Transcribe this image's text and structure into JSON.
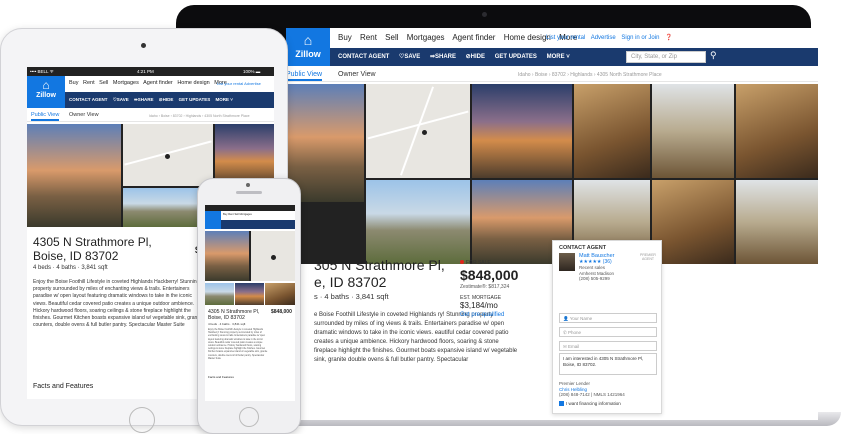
{
  "listing": {
    "address_line1": "4305 N Strathmore Pl,",
    "address_line2": "Boise, ID 83702",
    "address_line1_cut": "305 N Strathmore Pl,",
    "address_line2_cut": "e, ID 83702",
    "meta": "4 beds · 4 baths · 3,841 sqft",
    "meta_cut": "s · 4 baths · 3,841 sqft",
    "status": "FOR SALE",
    "price": "$848,000",
    "zestimate": "Zestimate®: $817,324",
    "est_mortgage_label": "EST. MORTGAGE",
    "est_mortgage_value": "$3,184/mo",
    "prequalified": "Get pre-qualified",
    "description": "Enjoy the Boise Foothill Lifestyle in coveted Highlands Hackberry! Stunning property surrounded by miles of enchanting views & trails. Entertainers paradise w/ open layout featuring dramatic windows to take in the iconic views. Beautiful cedar covered patio creates a unique outdoor ambience. Hickory hardwood floors, soaring ceilings & stone fireplace highlight the finishes. Gourmet Kitchen boasts expansive island w/ vegetable sink, granite counters, double ovens & full butler pantry. Spectacular Master Suite",
    "description_cut": "e Boise Foothill Lifestyle in coveted Highlands ry! Stunning property surrounded by miles of ing views & trails. Entertainers paradise w/ open dramatic windows to take in the iconic views. eautiful cedar covered patio creates a unique ambience. Hickory hardwood floors, soaring & stone fireplace highlight the finishes. Gourmet boats expansive island w/ vegetable sink, granite double ovens & full butler pantry. Spectacular",
    "facts_heading": "Facts and Features"
  },
  "nav": {
    "logo_text": "Zillow",
    "items": [
      "Buy",
      "Rent",
      "Sell",
      "Mortgages",
      "Agent finder",
      "Home design",
      "More"
    ],
    "right_links": [
      "List your rental",
      "Advertise",
      "Sign in or Join"
    ],
    "toolbar": [
      "CONTACT AGENT",
      "♡SAVE",
      "⇛SHARE",
      "⊘HIDE",
      "GET UPDATES",
      "MORE ˅"
    ],
    "search_placeholder": "City, State, or Zip",
    "tabs": [
      "Public View",
      "Owner View"
    ],
    "breadcrumb": "Idaho › Boise › 83702 › Highlands › 4305 North Strathmore Place"
  },
  "contact": {
    "heading": "CONTACT AGENT",
    "agent_name": "Matt Bauscher",
    "stars": "★★★★★ (36)",
    "recent_sales": "Recent sales",
    "brokerage": "Amherst Madison",
    "phone": "(208) 505-9299",
    "premier_badge": "PREMIER AGENT",
    "name_placeholder": "Your Name",
    "phone_placeholder": "Phone",
    "email_placeholder": "Email",
    "message": "I am interested in 4305 N Strathmore Pl, Boise, ID 83702.",
    "lender_label": "Premier Lender",
    "lender_name": "Chris Helbling",
    "lender_phone": "(208) 848-7142 | NMLS 1421964",
    "financing": "I want financing information"
  },
  "tablet_status": {
    "carrier": "•••• BELL ᯤ",
    "time": "4:21 PM",
    "battery": "100% ▬"
  },
  "colors": {
    "brand_blue": "#1277e1",
    "toolbar_navy": "#1a3a6e",
    "sale_red": "#e0251b"
  }
}
